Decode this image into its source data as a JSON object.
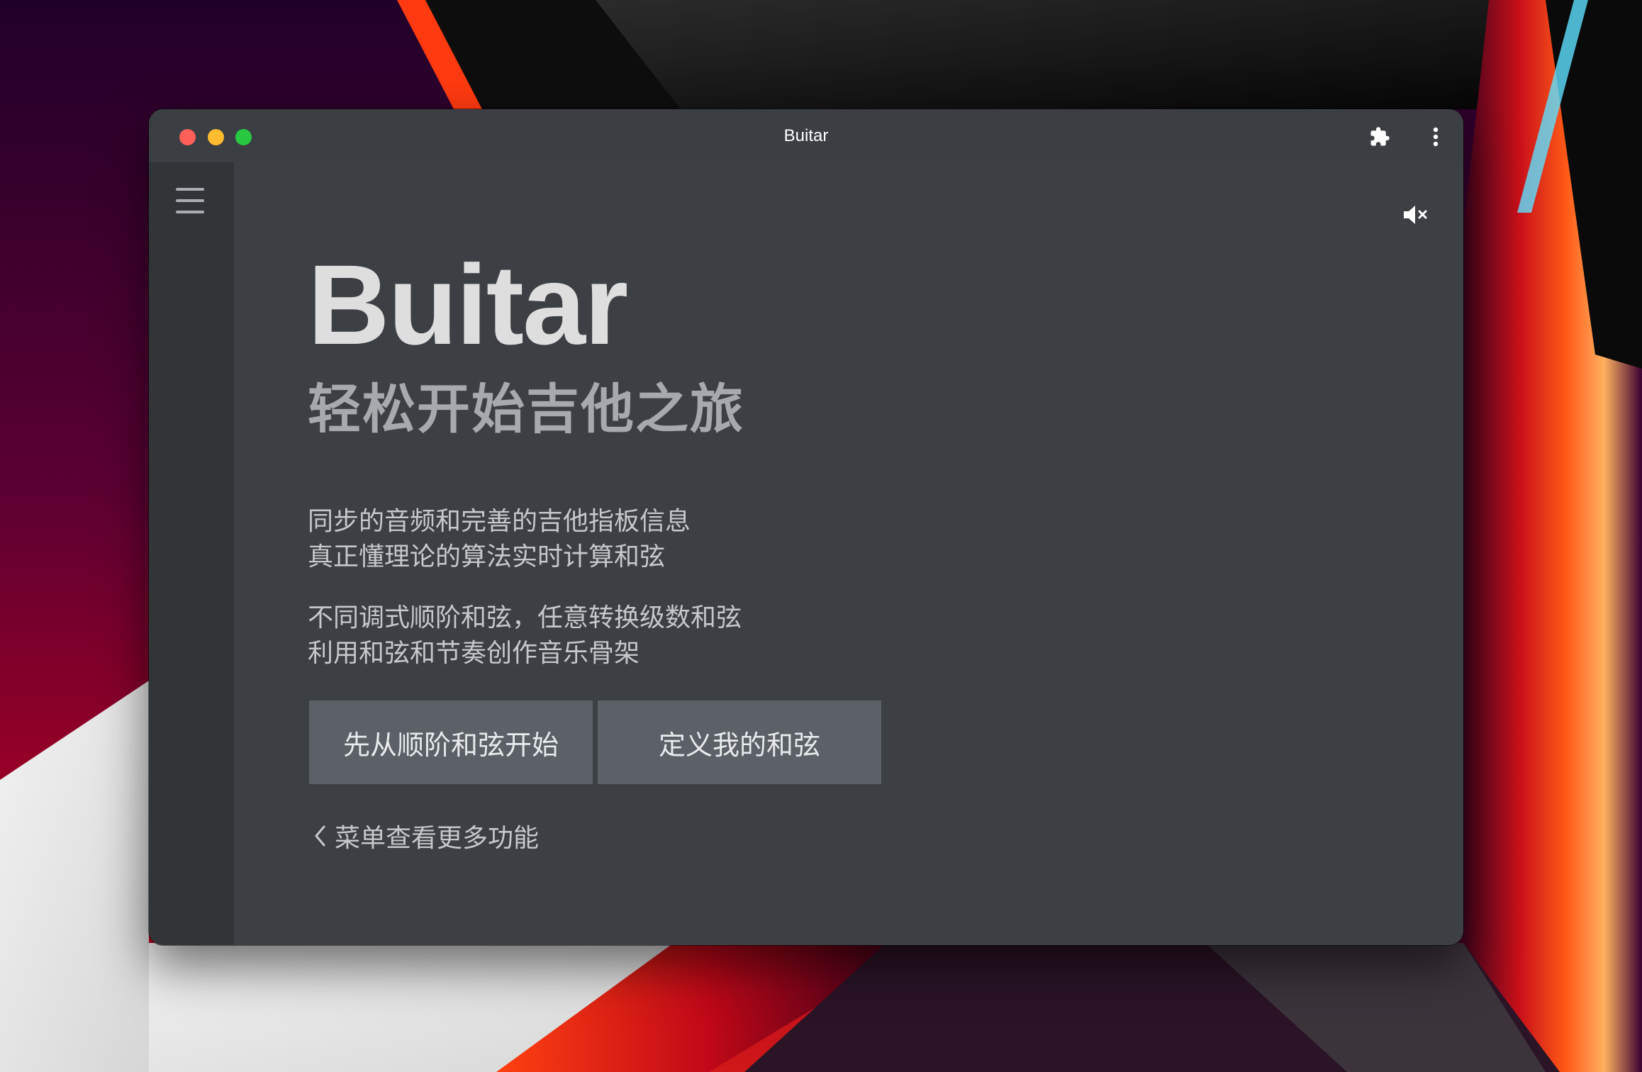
{
  "window": {
    "title": "Buitar"
  },
  "toolbar": {
    "extensions_icon": "puzzle-piece-icon",
    "more_icon": "vertical-ellipsis-icon"
  },
  "sidebar": {
    "menu_icon": "hamburger-menu-icon"
  },
  "sound": {
    "icon": "speaker-muted-icon"
  },
  "hero": {
    "title": "Buitar",
    "subtitle": "轻松开始吉他之旅"
  },
  "features": {
    "line1": "同步的音频和完善的吉他指板信息",
    "line2": "真正懂理论的算法实时计算和弦",
    "line3": "不同调式顺阶和弦，任意转换级数和弦",
    "line4": "利用和弦和节奏创作音乐骨架"
  },
  "actions": {
    "start_label": "先从顺阶和弦开始",
    "define_label": "定义我的和弦"
  },
  "hint": {
    "label": "菜单查看更多功能",
    "icon": "chevron-left-icon"
  },
  "colors": {
    "window_bg": "#3c3f43",
    "sidebar_bg": "#323537",
    "button_bg": "#5b6167",
    "close": "#fe5f57",
    "minimize": "#febc2e",
    "zoom": "#28c840"
  }
}
